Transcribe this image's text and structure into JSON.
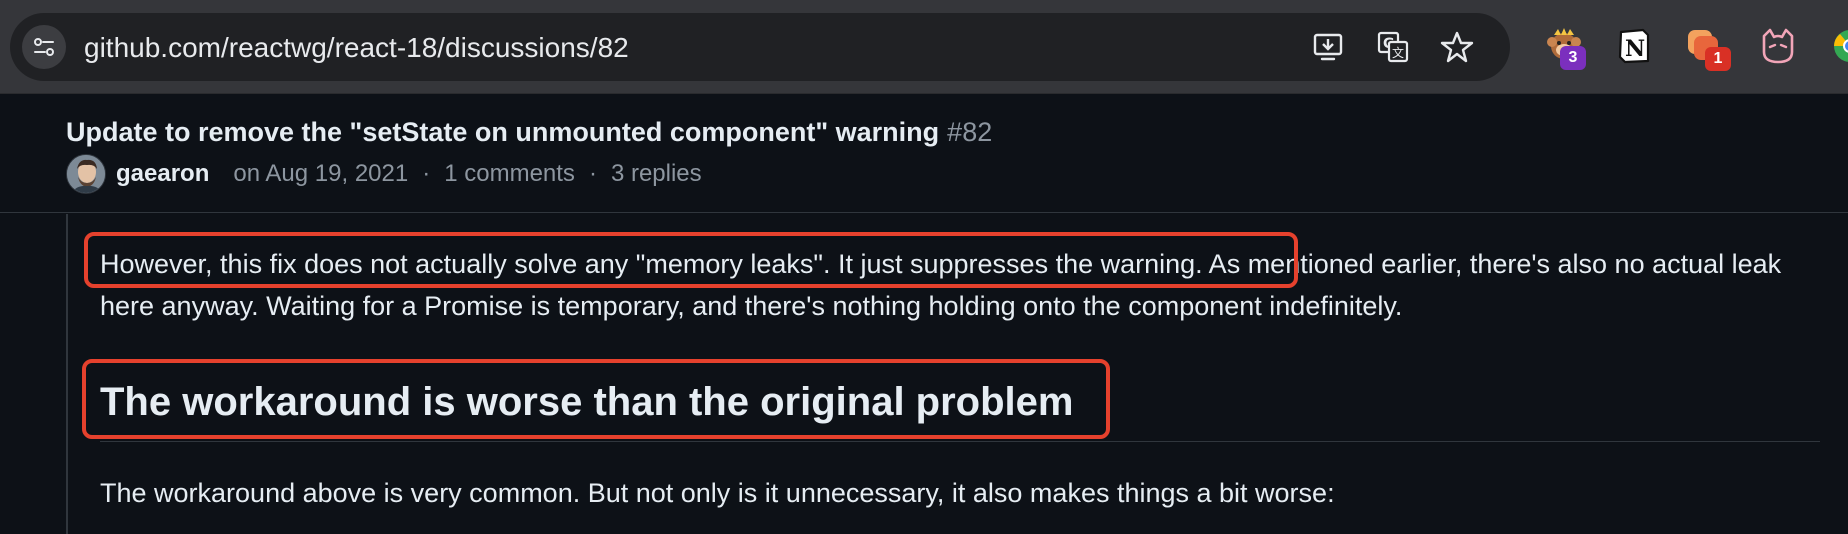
{
  "browser": {
    "url": "github.com/reactwg/react-18/discussions/82",
    "omnibox_icons": [
      "site-info-icon",
      "install-app-icon",
      "translate-icon",
      "bookmark-star-icon"
    ],
    "extensions": [
      {
        "name": "monkey-extension-icon",
        "badge": "3",
        "badge_color": "#7b2fbe"
      },
      {
        "name": "notion-extension-icon",
        "badge": ""
      },
      {
        "name": "stacked-app-extension-icon",
        "badge": "1",
        "badge_color": "#d93025"
      },
      {
        "name": "cat-extension-icon",
        "badge": ""
      },
      {
        "name": "chrome-partial-icon",
        "badge": ""
      }
    ]
  },
  "discussion": {
    "title": "Update to remove the \"setState on unmounted component\" warning",
    "number": "#82",
    "author": "gaearon",
    "date": "on Aug 19, 2021",
    "comments": "1 comments",
    "replies": "3 replies"
  },
  "body": {
    "p1_highlight": "However, this fix does not actually solve any \"memory leaks\". It just suppresses the warning.",
    "p1_rest": " As mentioned earlier, there's also no actual leak here anyway. Waiting for a Promise is temporary, and there's nothing holding onto the component indefinitely.",
    "heading": "The workaround is worse than the original problem",
    "p2": "The workaround above is very common. But not only is it unnecessary, it also makes things a bit worse:"
  },
  "colors": {
    "page_bg": "#0d1117",
    "chrome_bg": "#35363a",
    "omnibox_bg": "#202124",
    "text": "#e6edf3",
    "muted": "#8d96a0",
    "highlight_border": "#e5412d",
    "border": "#30363d"
  }
}
